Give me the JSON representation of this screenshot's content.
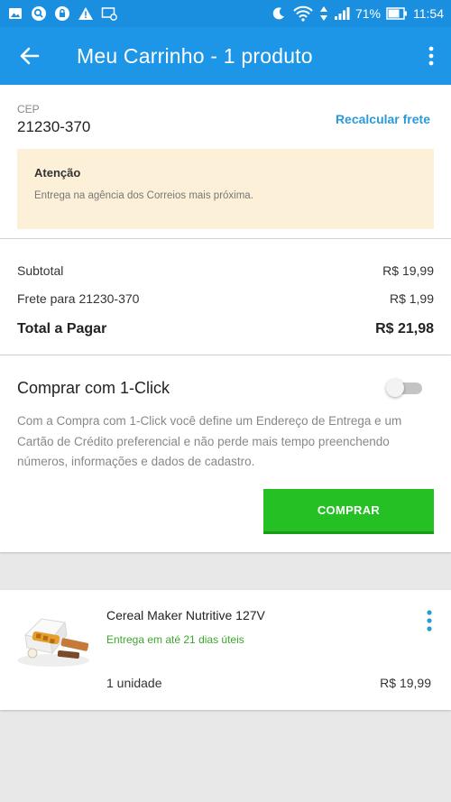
{
  "status_bar": {
    "battery": "71%",
    "time": "11:54"
  },
  "app_bar": {
    "title": "Meu Carrinho - 1 produto"
  },
  "shipping": {
    "cep_label": "CEP",
    "cep_value": "21230-370",
    "recalc_label": "Recalcular frete",
    "warning_title": "Atenção",
    "warning_text": "Entrega na agência dos Correios mais próxima."
  },
  "totals": {
    "subtotal_label": "Subtotal",
    "subtotal_value": "R$ 19,99",
    "freight_label": "Frete para 21230-370",
    "freight_value": "R$ 1,99",
    "total_label": "Total a Pagar",
    "total_value": "R$ 21,98"
  },
  "one_click": {
    "title": "Comprar com 1-Click",
    "enabled": false,
    "description": "Com a Compra com 1-Click você define um Endereço de Entrega e um Cartão de Crédito preferencial e não perde mais tempo preenchendo números, informações e dados de cadastro.",
    "buy_label": "COMPRAR"
  },
  "product": {
    "name": "Cereal Maker Nutritive 127V",
    "delivery": "Entrega em até 21 dias úteis",
    "quantity": "1 unidade",
    "price": "R$ 19,99"
  },
  "colors": {
    "primary": "#1e96e8",
    "status_bar": "#1a8fe0",
    "link": "#2b9ad8",
    "buy_button": "#25c023",
    "delivery_text": "#3aa82b",
    "warning_bg": "#fcf1d8"
  }
}
